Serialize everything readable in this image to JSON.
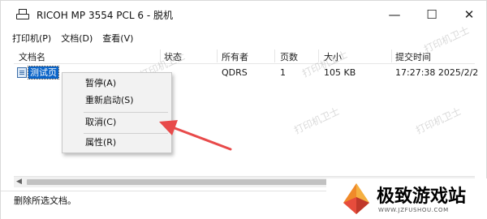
{
  "window": {
    "title": "RICOH MP 3554 PCL 6 - 脱机",
    "controls": {
      "minimize": "—",
      "maximize": "☐",
      "close": "✕"
    }
  },
  "menu": [
    "打印机(P)",
    "文档(D)",
    "查看(V)"
  ],
  "columns": [
    "文档名",
    "状态",
    "所有者",
    "页数",
    "大小",
    "提交时间"
  ],
  "jobs": [
    {
      "name": "测试页",
      "status": "",
      "owner": "QDRS",
      "pages": "1",
      "size": "105 KB",
      "submitted": "17:27:38   2025/2/2"
    }
  ],
  "context_menu": {
    "items": [
      "暂停(A)",
      "重新启动(S)",
      "取消(C)",
      "属性(R)"
    ]
  },
  "status_bar": "删除所选文档。",
  "watermark": "打印机卫士",
  "brand": {
    "name": "极致游戏站",
    "url": "WWW.JZFUSHOU.COM"
  },
  "colors": {
    "selection": "#0a64c8",
    "arrow": "#e84a4a",
    "brand_orange": "#f08a2a"
  }
}
